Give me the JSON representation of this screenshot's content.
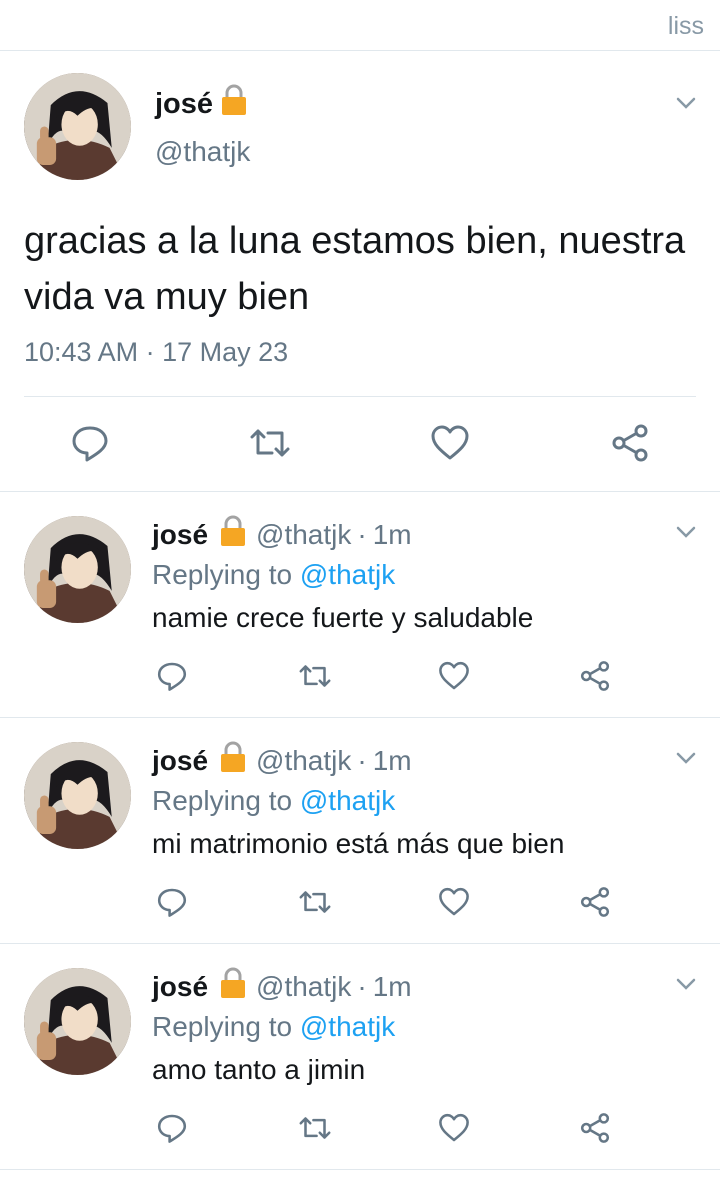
{
  "watermark": "liss",
  "main_tweet": {
    "name": "josé",
    "handle": "@thatjk",
    "text": "gracias a la luna estamos bien, nuestra vida va muy bien",
    "timestamp": "10:43 AM · 17 May 23",
    "icons": [
      "lock-icon",
      "chevron-down-icon",
      "reply-icon",
      "retweet-icon",
      "like-icon",
      "share-icon"
    ]
  },
  "replies": [
    {
      "name": "josé",
      "handle": "@thatjk",
      "separator": "·",
      "time": "1m",
      "replying_prefix": "Replying to",
      "replying_to": "@thatjk",
      "text": "namie crece fuerte y saludable"
    },
    {
      "name": "josé",
      "handle": "@thatjk",
      "separator": "·",
      "time": "1m",
      "replying_prefix": "Replying to",
      "replying_to": "@thatjk",
      "text": "mi matrimonio está más que bien"
    },
    {
      "name": "josé",
      "handle": "@thatjk",
      "separator": "·",
      "time": "1m",
      "replying_prefix": "Replying to",
      "replying_to": "@thatjk",
      "text": "amo tanto a jimin"
    }
  ],
  "colors": {
    "accent": "#1da1f2",
    "secondary_text": "#657786",
    "lock": "#f5a623",
    "divider": "#e1e8ed"
  }
}
